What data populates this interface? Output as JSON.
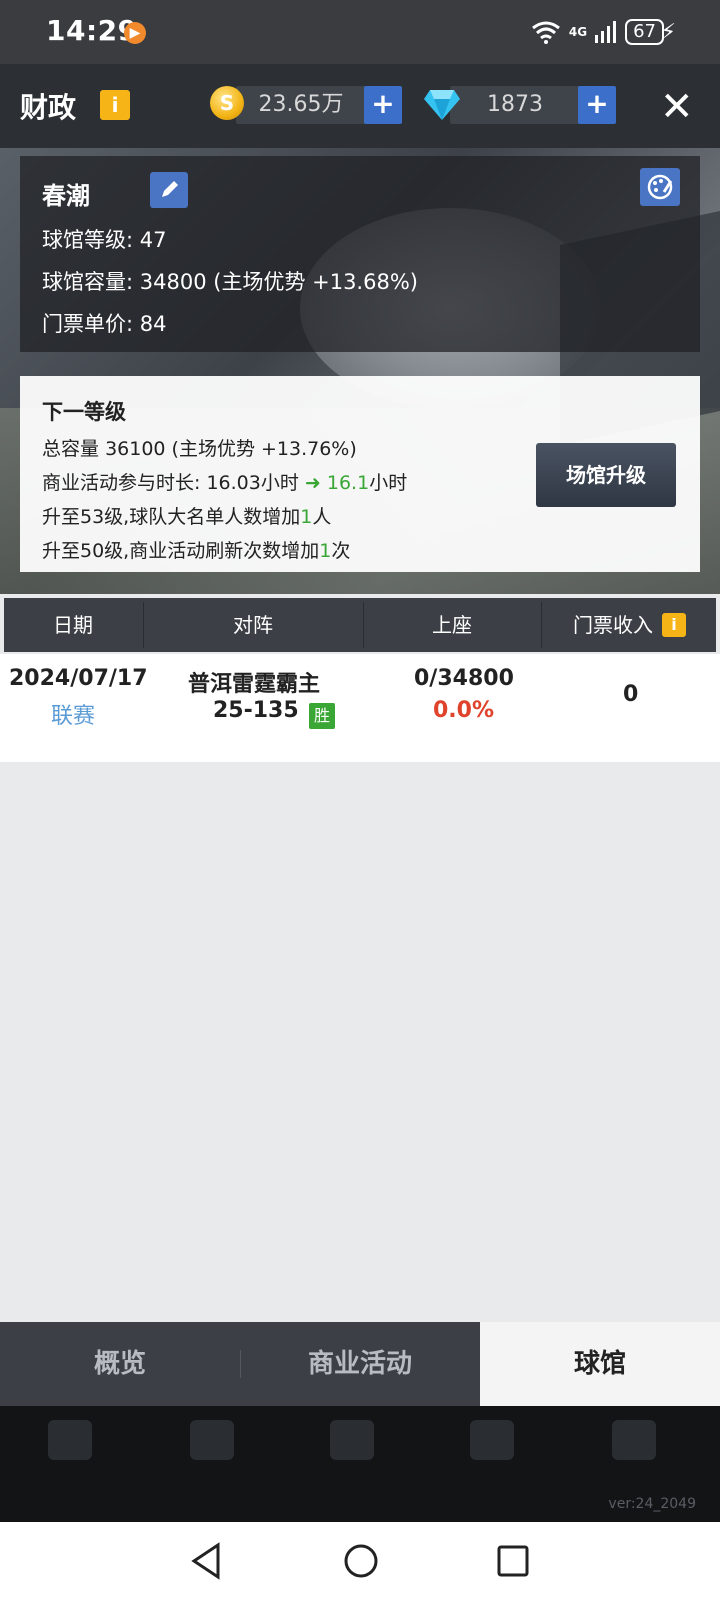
{
  "status_bar": {
    "time": "14:29",
    "network": "4G",
    "battery": "67"
  },
  "header": {
    "title": "财政",
    "gold": "23.65万",
    "diamonds": "1873"
  },
  "venue": {
    "name": "春潮",
    "level_label": "球馆等级:",
    "level": "47",
    "capacity_label": "球馆容量:",
    "capacity": "34800 (主场优势 +13.68%)",
    "ticket_label": "门票单价:",
    "ticket_price": "84"
  },
  "next_level": {
    "title": "下一等级",
    "total_capacity_label": "总容量",
    "total_capacity": "36100 (主场优势 +13.76%)",
    "business_label": "商业活动参与时长:",
    "business_from": "16.03小时",
    "business_to_num": "16.1",
    "business_to_unit": "小时",
    "line3_pre": "升至53级,球队大名单人数增加",
    "line3_num": "1",
    "line3_post": "人",
    "line4_pre": "升至50级,商业活动刷新次数增加",
    "line4_num": "1",
    "line4_post": "次",
    "upgrade_button": "场馆升级"
  },
  "table": {
    "headers": [
      "日期",
      "对阵",
      "上座",
      "门票收入"
    ],
    "rows": [
      {
        "date": "2024/07/17",
        "type": "联赛",
        "opponent": "普洱雷霆霸主",
        "score": "25-135",
        "result": "胜",
        "attendance": "0/34800",
        "attendance_pct": "0.0%",
        "revenue": "0"
      }
    ]
  },
  "tabs": [
    "概览",
    "商业活动",
    "球馆"
  ],
  "active_tab": "球馆",
  "version": "ver:24_2049",
  "colors": {
    "accent_blue": "#4a74c4",
    "win_green": "#3aa635",
    "alert_red": "#e0432c",
    "info_yellow": "#f6b416"
  }
}
